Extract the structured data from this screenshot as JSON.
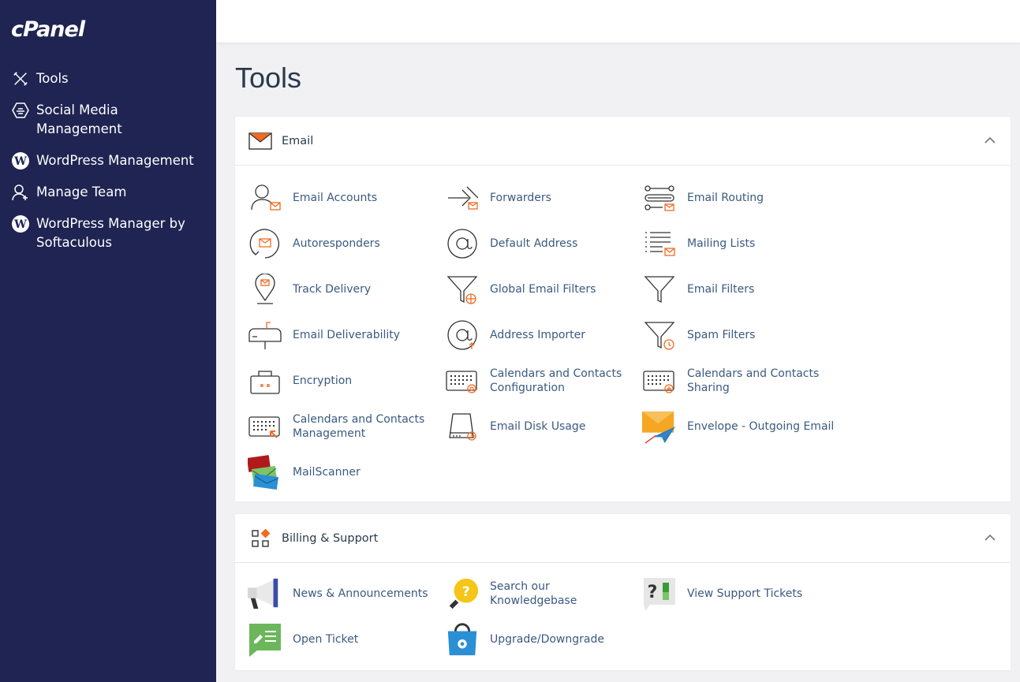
{
  "brand": {
    "logo_text": "cPanel"
  },
  "sidebar": {
    "items": [
      {
        "label": "Tools",
        "icon": "tools-icon"
      },
      {
        "label": "Social Media Management",
        "icon": "social-media-icon"
      },
      {
        "label": "WordPress Management",
        "icon": "wordpress-icon"
      },
      {
        "label": "Manage Team",
        "icon": "manage-team-icon"
      },
      {
        "label": "WordPress Manager by Softaculous",
        "icon": "wordpress-icon"
      }
    ]
  },
  "page": {
    "title": "Tools"
  },
  "sections": {
    "email": {
      "title": "Email",
      "items": [
        "Email Accounts",
        "Forwarders",
        "Email Routing",
        "Autoresponders",
        "Default Address",
        "Mailing Lists",
        "Track Delivery",
        "Global Email Filters",
        "Email Filters",
        "Email Deliverability",
        "Address Importer",
        "Spam Filters",
        "Encryption",
        "Calendars and Contacts Configuration",
        "Calendars and Contacts Sharing",
        "Calendars and Contacts Management",
        "Email Disk Usage",
        "Envelope - Outgoing Email",
        "MailScanner"
      ]
    },
    "billing": {
      "title": "Billing & Support",
      "items": [
        "News & Announcements",
        "Search our Knowledgebase",
        "View Support Tickets",
        "Open Ticket",
        "Upgrade/Downgrade"
      ]
    }
  },
  "colors": {
    "sidebar_bg": "#1f2452",
    "accent": "#f26b21",
    "link": "#3a5a80"
  }
}
